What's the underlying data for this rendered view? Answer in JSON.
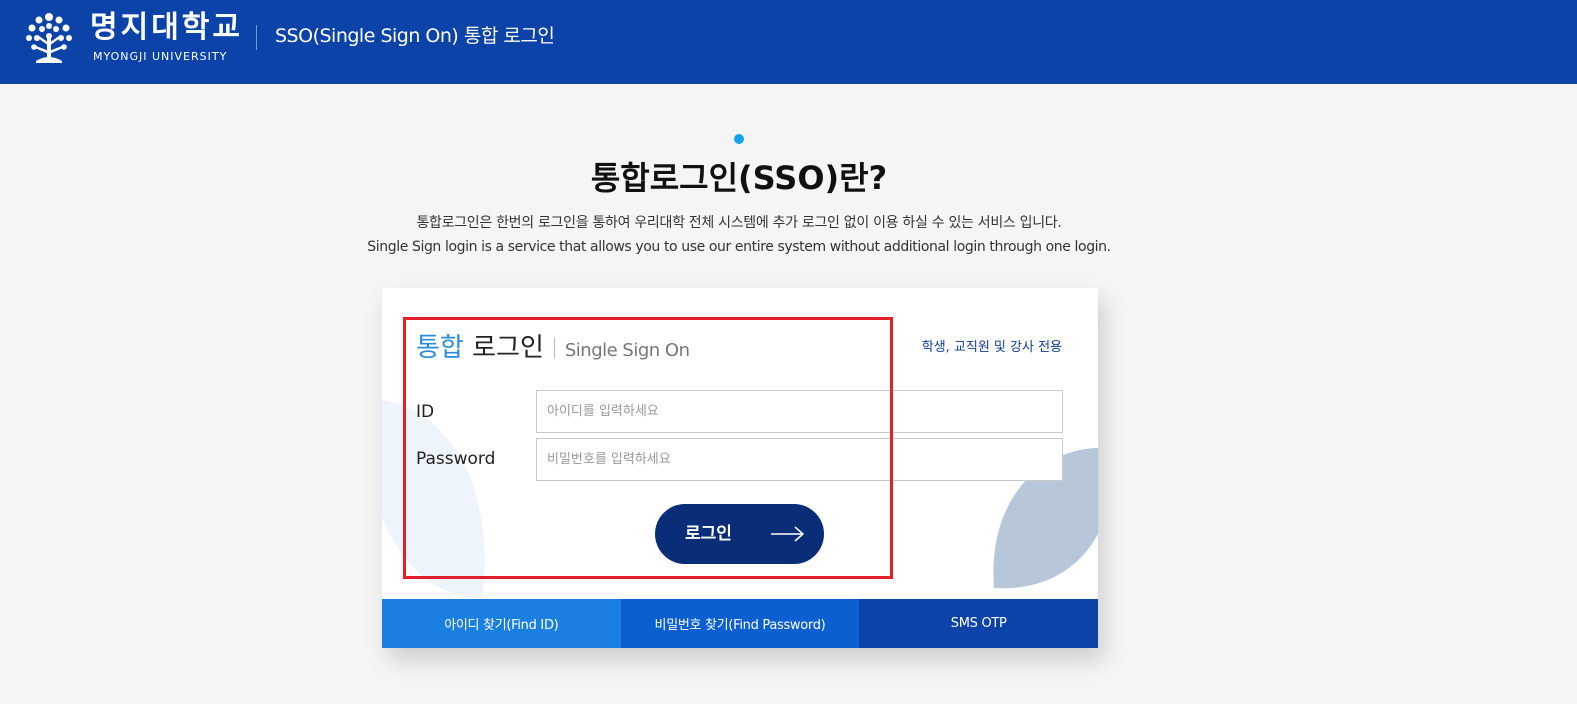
{
  "header": {
    "logo_kr": "명지대학교",
    "logo_en": "MYONGJI UNIVERSITY",
    "title": "SSO(Single Sign On) 통합 로그인"
  },
  "intro": {
    "title": "통합로그인(SSO)란?",
    "description_kr": "통합로그인은 한번의 로그인을 통하여 우리대학 전체 시스템에 추가 로그인 없이 이용 하실 수 있는 서비스 입니다.",
    "description_en": "Single Sign login is a service that allows you to use our entire system without additional login through one login."
  },
  "login_card": {
    "title_accent": "통합",
    "title_main": "로그인",
    "title_sub": "Single Sign On",
    "notice": "학생, 교직원 및 강사 전용",
    "id_label": "ID",
    "id_placeholder": "아이디를 입력하세요",
    "id_value": "",
    "password_label": "Password",
    "password_placeholder": "비밀번호를 입력하세요",
    "password_value": "",
    "login_button": "로그인",
    "login_icon": "arrow-right-icon"
  },
  "tabs": [
    {
      "label": "아이디 찾기(Find ID)"
    },
    {
      "label": "비밀번호 찾기(Find Password)"
    },
    {
      "label": "SMS OTP"
    }
  ],
  "colors": {
    "header_bg": "#0b43a8",
    "accent": "#2a8ddc",
    "login_button": "#0a2d78",
    "tab_1": "#1a7fe0",
    "tab_2": "#0b5fd0",
    "tab_3": "#0b43a8",
    "highlight": "#e0202c"
  }
}
